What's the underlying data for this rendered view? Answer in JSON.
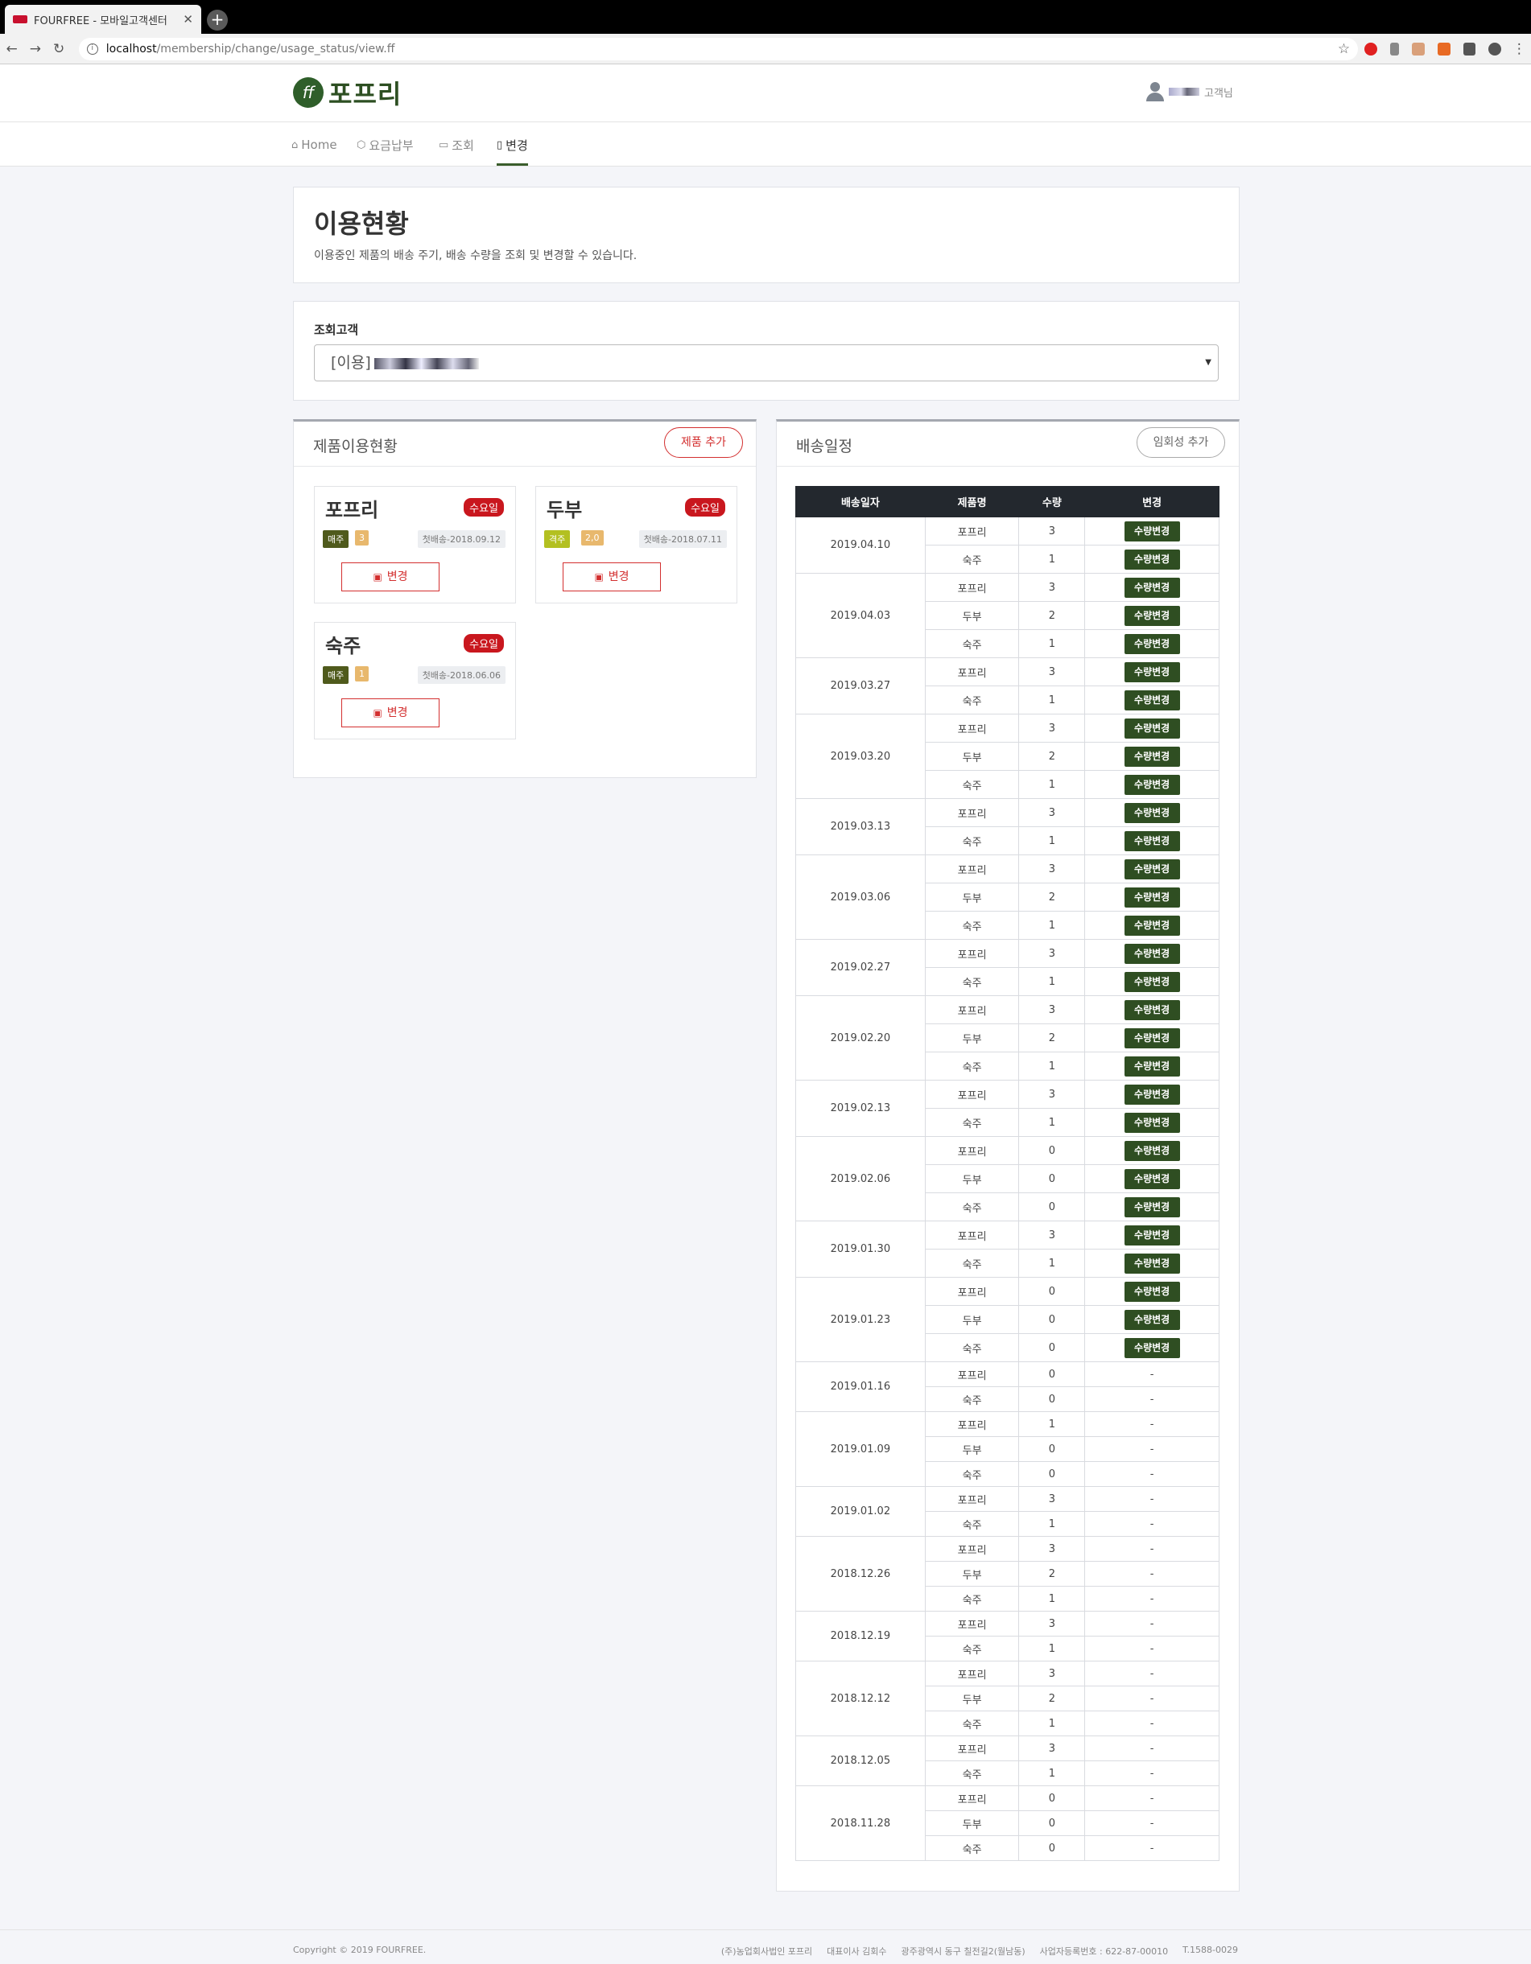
{
  "browser": {
    "tab_title": "FOURFREE - 모바일고객센터",
    "url_host": "localhost",
    "url_path": "/membership/change/usage_status/view.ff"
  },
  "header": {
    "logo_text": "포프리",
    "user_suffix": "고객님"
  },
  "nav": [
    {
      "label": "Home",
      "icon": "home-icon",
      "active": false
    },
    {
      "label": "요금납부",
      "icon": "package-icon",
      "active": false
    },
    {
      "label": "조회",
      "icon": "calendar-icon",
      "active": false
    },
    {
      "label": "변경",
      "icon": "document-icon",
      "active": true
    }
  ],
  "intro": {
    "title": "이용현황",
    "desc": "이용중인 제품의 배송 주기, 배송 수량을 조회 및 변경할 수 있습니다."
  },
  "customer": {
    "label": "조회고객",
    "selected_prefix": "[이용]"
  },
  "products": {
    "title": "제품이용현황",
    "add_label": "제품 추가",
    "items": [
      {
        "name": "포프리",
        "day": "수요일",
        "cycle": "매주",
        "cycle_color": "#4f5a1c",
        "qty": "3",
        "first": "첫배송-2018.09.12",
        "change": "변경"
      },
      {
        "name": "두부",
        "day": "수요일",
        "cycle": "격주",
        "cycle_color": "#b3c021",
        "qty": "2,0",
        "first": "첫배송-2018.07.11",
        "change": "변경"
      },
      {
        "name": "숙주",
        "day": "수요일",
        "cycle": "매주",
        "cycle_color": "#4f5a1c",
        "qty": "1",
        "first": "첫배송-2018.06.06",
        "change": "변경"
      }
    ]
  },
  "schedule": {
    "title": "배송일정",
    "add_label": "임회성 추가",
    "columns": [
      "배송일자",
      "제품명",
      "수량",
      "변경"
    ],
    "btn_label": "수량변경",
    "none_label": "-",
    "groups": [
      {
        "date": "2019.04.10",
        "btn": true,
        "rows": [
          [
            "포프리",
            "3"
          ],
          [
            "숙주",
            "1"
          ]
        ]
      },
      {
        "date": "2019.04.03",
        "btn": true,
        "rows": [
          [
            "포프리",
            "3"
          ],
          [
            "두부",
            "2"
          ],
          [
            "숙주",
            "1"
          ]
        ]
      },
      {
        "date": "2019.03.27",
        "btn": true,
        "rows": [
          [
            "포프리",
            "3"
          ],
          [
            "숙주",
            "1"
          ]
        ]
      },
      {
        "date": "2019.03.20",
        "btn": true,
        "rows": [
          [
            "포프리",
            "3"
          ],
          [
            "두부",
            "2"
          ],
          [
            "숙주",
            "1"
          ]
        ]
      },
      {
        "date": "2019.03.13",
        "btn": true,
        "rows": [
          [
            "포프리",
            "3"
          ],
          [
            "숙주",
            "1"
          ]
        ]
      },
      {
        "date": "2019.03.06",
        "btn": true,
        "rows": [
          [
            "포프리",
            "3"
          ],
          [
            "두부",
            "2"
          ],
          [
            "숙주",
            "1"
          ]
        ]
      },
      {
        "date": "2019.02.27",
        "btn": true,
        "rows": [
          [
            "포프리",
            "3"
          ],
          [
            "숙주",
            "1"
          ]
        ]
      },
      {
        "date": "2019.02.20",
        "btn": true,
        "rows": [
          [
            "포프리",
            "3"
          ],
          [
            "두부",
            "2"
          ],
          [
            "숙주",
            "1"
          ]
        ]
      },
      {
        "date": "2019.02.13",
        "btn": true,
        "rows": [
          [
            "포프리",
            "3"
          ],
          [
            "숙주",
            "1"
          ]
        ]
      },
      {
        "date": "2019.02.06",
        "btn": true,
        "rows": [
          [
            "포프리",
            "0"
          ],
          [
            "두부",
            "0"
          ],
          [
            "숙주",
            "0"
          ]
        ]
      },
      {
        "date": "2019.01.30",
        "btn": true,
        "rows": [
          [
            "포프리",
            "3"
          ],
          [
            "숙주",
            "1"
          ]
        ]
      },
      {
        "date": "2019.01.23",
        "btn": true,
        "rows": [
          [
            "포프리",
            "0"
          ],
          [
            "두부",
            "0"
          ],
          [
            "숙주",
            "0"
          ]
        ]
      },
      {
        "date": "2019.01.16",
        "btn": false,
        "rows": [
          [
            "포프리",
            "0"
          ],
          [
            "숙주",
            "0"
          ]
        ]
      },
      {
        "date": "2019.01.09",
        "btn": false,
        "rows": [
          [
            "포프리",
            "1"
          ],
          [
            "두부",
            "0"
          ],
          [
            "숙주",
            "0"
          ]
        ]
      },
      {
        "date": "2019.01.02",
        "btn": false,
        "rows": [
          [
            "포프리",
            "3"
          ],
          [
            "숙주",
            "1"
          ]
        ]
      },
      {
        "date": "2018.12.26",
        "btn": false,
        "rows": [
          [
            "포프리",
            "3"
          ],
          [
            "두부",
            "2"
          ],
          [
            "숙주",
            "1"
          ]
        ]
      },
      {
        "date": "2018.12.19",
        "btn": false,
        "rows": [
          [
            "포프리",
            "3"
          ],
          [
            "숙주",
            "1"
          ]
        ]
      },
      {
        "date": "2018.12.12",
        "btn": false,
        "rows": [
          [
            "포프리",
            "3"
          ],
          [
            "두부",
            "2"
          ],
          [
            "숙주",
            "1"
          ]
        ]
      },
      {
        "date": "2018.12.05",
        "btn": false,
        "rows": [
          [
            "포프리",
            "3"
          ],
          [
            "숙주",
            "1"
          ]
        ]
      },
      {
        "date": "2018.11.28",
        "btn": false,
        "rows": [
          [
            "포프리",
            "0"
          ],
          [
            "두부",
            "0"
          ],
          [
            "숙주",
            "0"
          ]
        ]
      }
    ]
  },
  "footer": {
    "copyright": "Copyright © 2019 FOURFREE.",
    "company": "(주)농업회사법인 포프리",
    "ceo": "대표이사 김회수",
    "address": "광주광역시 동구 칠전길2(월남동)",
    "bizno": "사업자등록번호 : 622-87-00010",
    "tel": "T.1588-0029"
  }
}
